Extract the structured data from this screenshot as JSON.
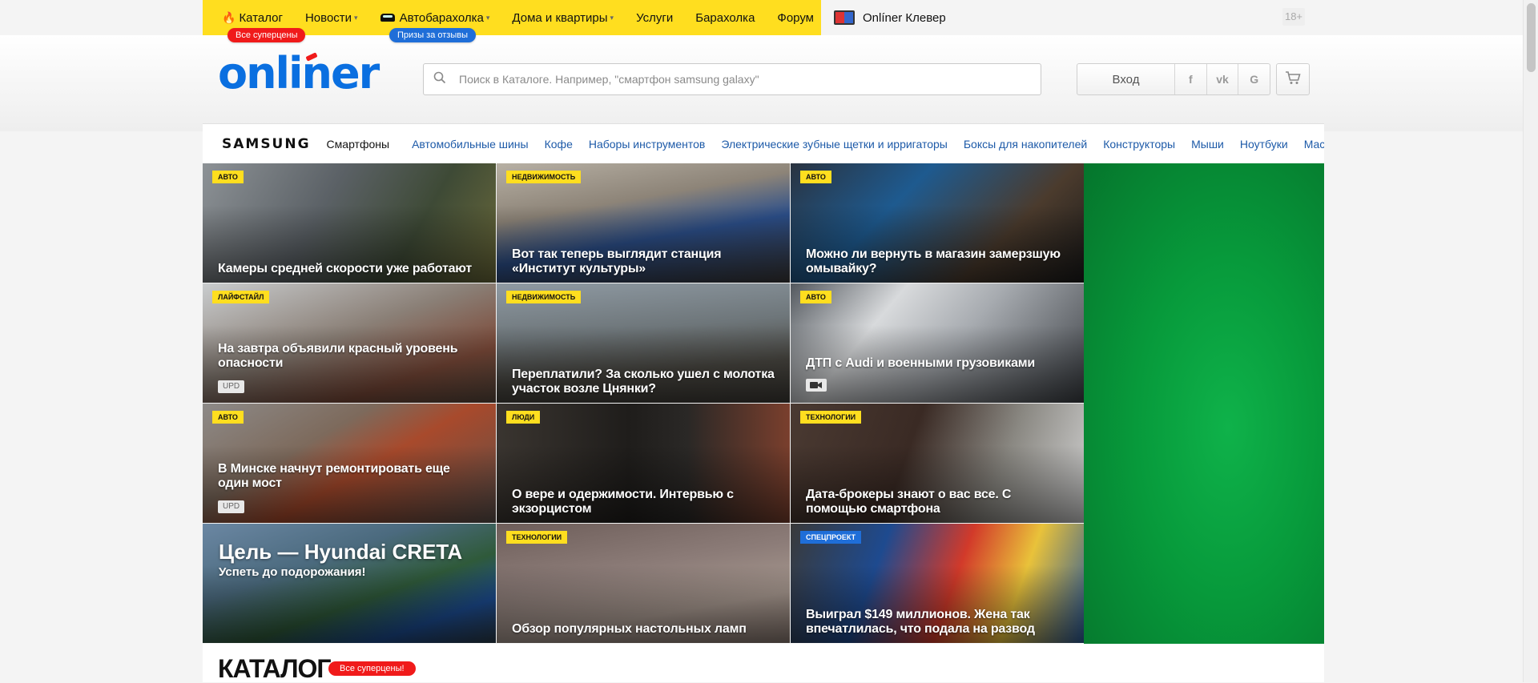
{
  "topnav": {
    "items": [
      {
        "label": "Каталог"
      },
      {
        "label": "Новости"
      },
      {
        "label": "Автобарахолка"
      },
      {
        "label": "Дома и квартиры"
      },
      {
        "label": "Услуги"
      },
      {
        "label": "Барахолка"
      },
      {
        "label": "Форум"
      }
    ],
    "pill_superprices": "Все суперцены",
    "pill_prizes": "Призы за отзывы",
    "clever": "Onlíner Клевер",
    "age": "18+"
  },
  "header": {
    "logo": "onliner",
    "search_placeholder": "Поиск в Каталоге. Например, \"смартфон samsung galaxy\"",
    "login": "Вход",
    "social": [
      "f",
      "vk",
      "G"
    ]
  },
  "catstrip": {
    "brand": "SAMSUNG",
    "sub": "Смартфоны",
    "links": [
      "Автомобильные шины",
      "Кофе",
      "Наборы инструментов",
      "Электрические зубные щетки и ирригаторы",
      "Боксы для накопителей",
      "Конструкторы",
      "Мыши",
      "Ноутбуки",
      "Мас"
    ]
  },
  "news": [
    {
      "badge": "АВТО",
      "title": "Камеры средней скорости уже работают"
    },
    {
      "badge": "НЕДВИЖИМОСТЬ",
      "title": "Вот так теперь выглядит станция «Институт культуры»"
    },
    {
      "badge": "АВТО",
      "title": "Можно ли вернуть в магазин замерзшую омывайку?"
    },
    {
      "badge": "ЛАЙФСТАЙЛ",
      "title": "На завтра объявили красный уровень опасности",
      "extra": "UPD"
    },
    {
      "badge": "НЕДВИЖИМОСТЬ",
      "title": "Переплатили? За сколько ушел с молотка участок возле Цнянки?"
    },
    {
      "badge": "АВТО",
      "title": "ДТП с Audi и военными грузовиками"
    },
    {
      "badge": "АВТО",
      "title": "В Минске начнут ремонтировать еще один мост",
      "extra": "UPD"
    },
    {
      "badge": "ЛЮДИ",
      "title": "О вере и одержимости. Интервью с экзорцистом"
    },
    {
      "badge": "ТЕХНОЛОГИИ",
      "title": "Дата-брокеры знают о вас все. С помощью смартфона"
    },
    {
      "promo_title": "Цель — Hyundai CRETA",
      "promo_sub": "Успеть до подорожания!"
    },
    {
      "badge": "ТЕХНОЛОГИИ",
      "title": "Обзор популярных настольных ламп"
    },
    {
      "badge": "СПЕЦПРОЕКТ",
      "title": "Выиграл $149 миллионов. Жена так впечатлилась, что подала на развод"
    }
  ],
  "catalog": {
    "title": "КАТАЛОГ",
    "pill": "Все суперцены!"
  },
  "colors": {
    "brand_yellow": "#ffde1f",
    "brand_blue": "#0a6fe0",
    "accent_red": "#f01a1a",
    "link_blue": "#1d5aa8",
    "ad_green": "#079a3b"
  }
}
